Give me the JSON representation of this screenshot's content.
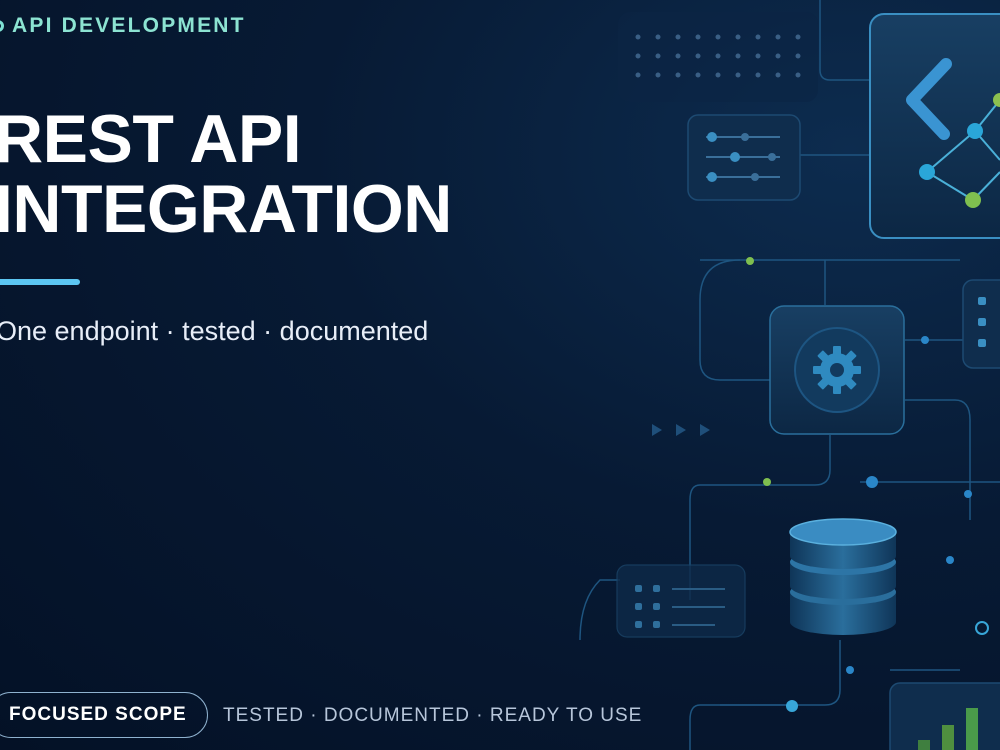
{
  "eyebrow": {
    "label": "API DEVELOPMENT"
  },
  "headline": {
    "line1": "REST API",
    "line2": "INTEGRATION"
  },
  "subtitle": "One endpoint · tested · documented",
  "badge": {
    "label": "FOCUSED SCOPE"
  },
  "tagline": "TESTED · DOCUMENTED · READY TO USE",
  "colors": {
    "background": "#041126",
    "accent": "#5cc6f2",
    "eyebrow": "#8ce3d2"
  },
  "illustration": {
    "icons": [
      "code-bracket-icon",
      "node-graph-icon",
      "gear-icon",
      "database-icon",
      "list-card-icon",
      "slider-card-icon",
      "bar-chart-icon"
    ]
  }
}
